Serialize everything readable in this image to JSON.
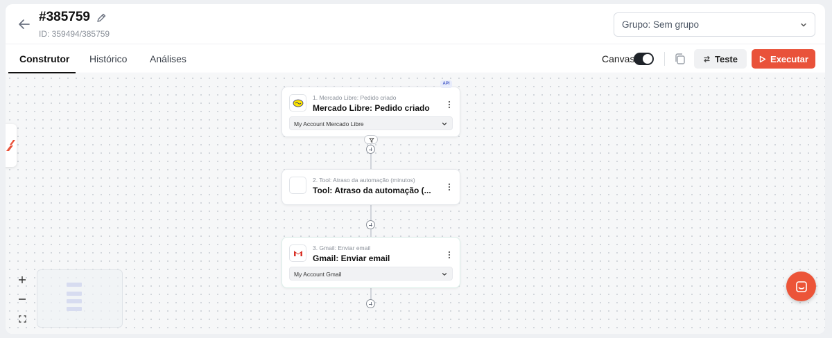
{
  "header": {
    "title": "#385759",
    "subtitle": "ID: 359494/385759",
    "back_icon": "arrow-left-icon",
    "edit_icon": "pencil-icon",
    "group_select": "Grupo: Sem grupo"
  },
  "tabs": [
    {
      "label": "Construtor",
      "active": true
    },
    {
      "label": "Histórico",
      "active": false
    },
    {
      "label": "Análises",
      "active": false
    }
  ],
  "toolbar": {
    "canvas_label": "Canvas",
    "canvas_toggle_on": true,
    "test_label": "Teste",
    "execute_label": "Executar"
  },
  "colors": {
    "accent": "#e9523a",
    "toggle": "#1f2329"
  },
  "nodes": [
    {
      "step_label": "1. Mercado Libre: Pedido criado",
      "title": "Mercado Libre: Pedido criado",
      "account": "My Account Mercado Libre",
      "badge": "API",
      "icon": "mercado-libre-icon"
    },
    {
      "step_label": "2. Tool: Atraso da automação (minutos)",
      "title": "Tool: Atraso da automação (...",
      "icon": "tool-icon"
    },
    {
      "step_label": "3. Gmail: Enviar email",
      "title": "Gmail: Enviar email",
      "account": "My Account Gmail",
      "icon": "gmail-icon"
    }
  ]
}
